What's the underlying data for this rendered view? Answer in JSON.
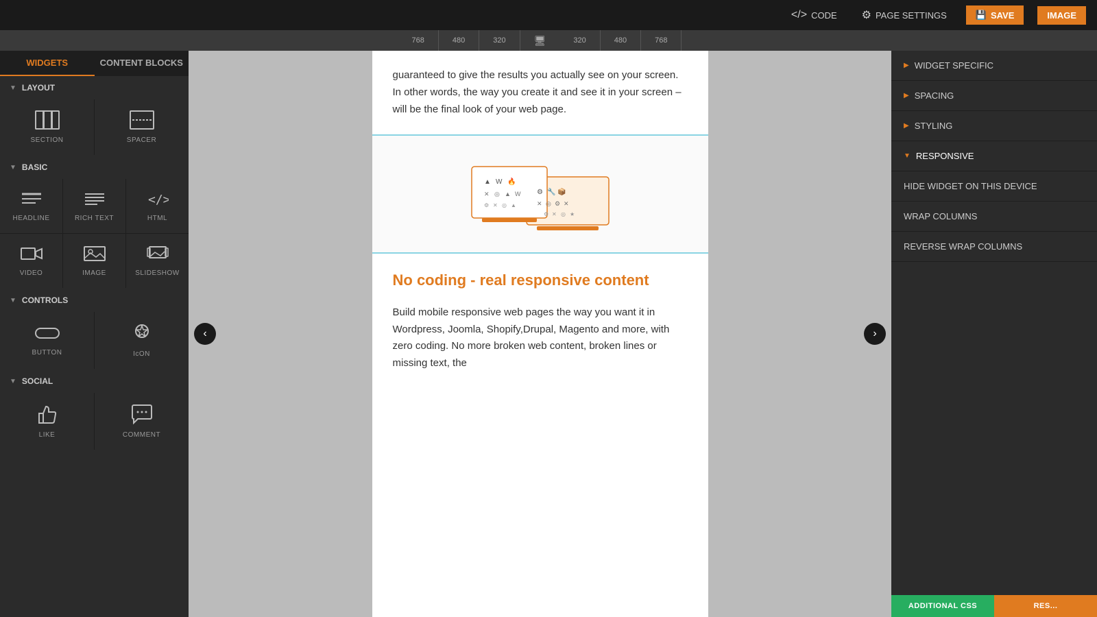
{
  "topbar": {
    "code_label": "CODE",
    "page_settings_label": "PAGE SETTINGS",
    "save_label": "SAVE",
    "image_label": "IMAGE"
  },
  "ruler": {
    "marks": [
      "768",
      "480",
      "320",
      "",
      "320",
      "480",
      "768"
    ]
  },
  "tabs": {
    "widgets_label": "WIDGETS",
    "content_blocks_label": "CONTENT BLOCKS"
  },
  "sidebar": {
    "layout_section": "LAYOUT",
    "basic_section": "BASIC",
    "controls_section": "CONTROLS",
    "social_section": "SOCIAL",
    "layout_widgets": [
      {
        "label": "SECTION",
        "icon": "section"
      },
      {
        "label": "SPACER",
        "icon": "spacer"
      }
    ],
    "basic_widgets": [
      {
        "label": "HEADLINE",
        "icon": "headline"
      },
      {
        "label": "RICH TEXT",
        "icon": "richtext"
      },
      {
        "label": "HTML",
        "icon": "html"
      },
      {
        "label": "VIDEO",
        "icon": "video"
      },
      {
        "label": "IMAGE",
        "icon": "image"
      },
      {
        "label": "SLIDESHOW",
        "icon": "slideshow"
      }
    ],
    "controls_widgets": [
      {
        "label": "BUTTON",
        "icon": "button"
      },
      {
        "label": "ICON",
        "icon": "icon"
      }
    ],
    "social_widgets": [
      {
        "label": "LIKE",
        "icon": "like"
      },
      {
        "label": "COMMENT",
        "icon": "comment"
      }
    ]
  },
  "canvas": {
    "paragraph1": "guaranteed to give the results you actually see on your screen. In other words, the way you create it and see it in your screen – will be the final look of your web page.",
    "heading": "No coding - real responsive content",
    "paragraph2": "Build mobile responsive web pages the way you want it in Wordpress, Joomla, Shopify,Drupal, Magento and more, with zero coding. No more broken web content, broken lines or missing text, the"
  },
  "right_panel": {
    "widget_specific_label": "WIDGET SPECIFIC",
    "spacing_label": "SPACING",
    "styling_label": "STYLING",
    "responsive_label": "RESPONSIVE",
    "hide_widget_label": "HIDE WIDGET ON THIS DEVICE",
    "wrap_columns_label": "WRAP COLUMNS",
    "reverse_wrap_columns_label": "REVERSE WRAP COLUMNS"
  },
  "bottom_bar": {
    "additional_css_label": "ADDITIONAL CSS",
    "reset_label": "RES..."
  }
}
